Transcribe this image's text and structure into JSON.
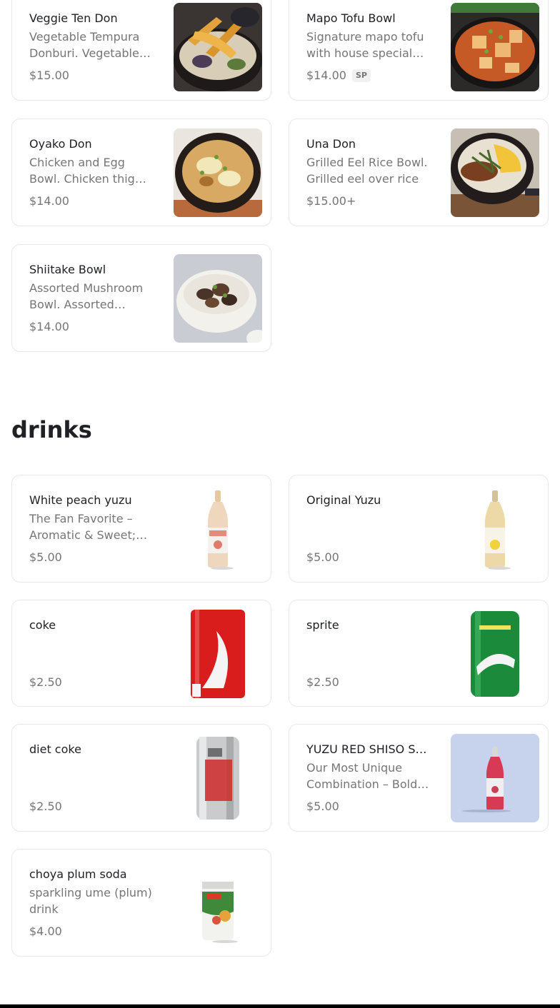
{
  "menu_top": [
    {
      "name": "Veggie Ten Don",
      "desc": "Vegetable Tempura Donburi. Vegetable tempura over rice",
      "price": "$15.00",
      "badge": "",
      "image": "tempura-donburi-photo"
    },
    {
      "name": "Mapo Tofu Bowl",
      "desc": "Signature mapo tofu with house special sauce",
      "price": "$14.00",
      "badge": "SP",
      "image": "mapo-tofu-photo"
    },
    {
      "name": "Oyako Don",
      "desc": "Chicken and Egg Bowl. Chicken thigh and egg",
      "price": "$14.00",
      "badge": "",
      "image": "oyako-don-photo"
    },
    {
      "name": "Una Don",
      "desc": "Grilled Eel Rice Bowl. Grilled eel over rice",
      "price": "$15.00+",
      "badge": "",
      "image": "una-don-photo"
    },
    {
      "name": "Shiitake Bowl",
      "desc": "Assorted Mushroom Bowl. Assorted mushrooms",
      "price": "$14.00",
      "badge": "",
      "image": "mushroom-bowl-photo"
    }
  ],
  "drinks_section": {
    "title": "drinks"
  },
  "drinks": [
    {
      "name": "White peach yuzu",
      "desc": "The Fan Favorite – Aromatic & Sweet; white peach",
      "price": "$5.00",
      "image": "peach-yuzu-bottle"
    },
    {
      "name": "Original Yuzu",
      "desc": "",
      "price": "$5.00",
      "image": "yuzu-bottle"
    },
    {
      "name": "coke",
      "desc": "",
      "price": "$2.50",
      "image": "coke-can"
    },
    {
      "name": "sprite",
      "desc": "",
      "price": "$2.50",
      "image": "sprite-can"
    },
    {
      "name": "diet coke",
      "desc": "",
      "price": "$2.50",
      "image": "diet-coke-can"
    },
    {
      "name": "YUZU RED SHISO SODA",
      "desc": "Our Most Unique Combination – Bold and refreshing",
      "price": "$5.00",
      "image": "red-shiso-bottle"
    },
    {
      "name": "choya plum soda",
      "desc": "sparkling ume (plum) drink",
      "price": "$4.00",
      "image": "choya-can"
    }
  ],
  "colors": {
    "text": "#202125",
    "muted": "#767676",
    "border": "#e8e8e8"
  }
}
